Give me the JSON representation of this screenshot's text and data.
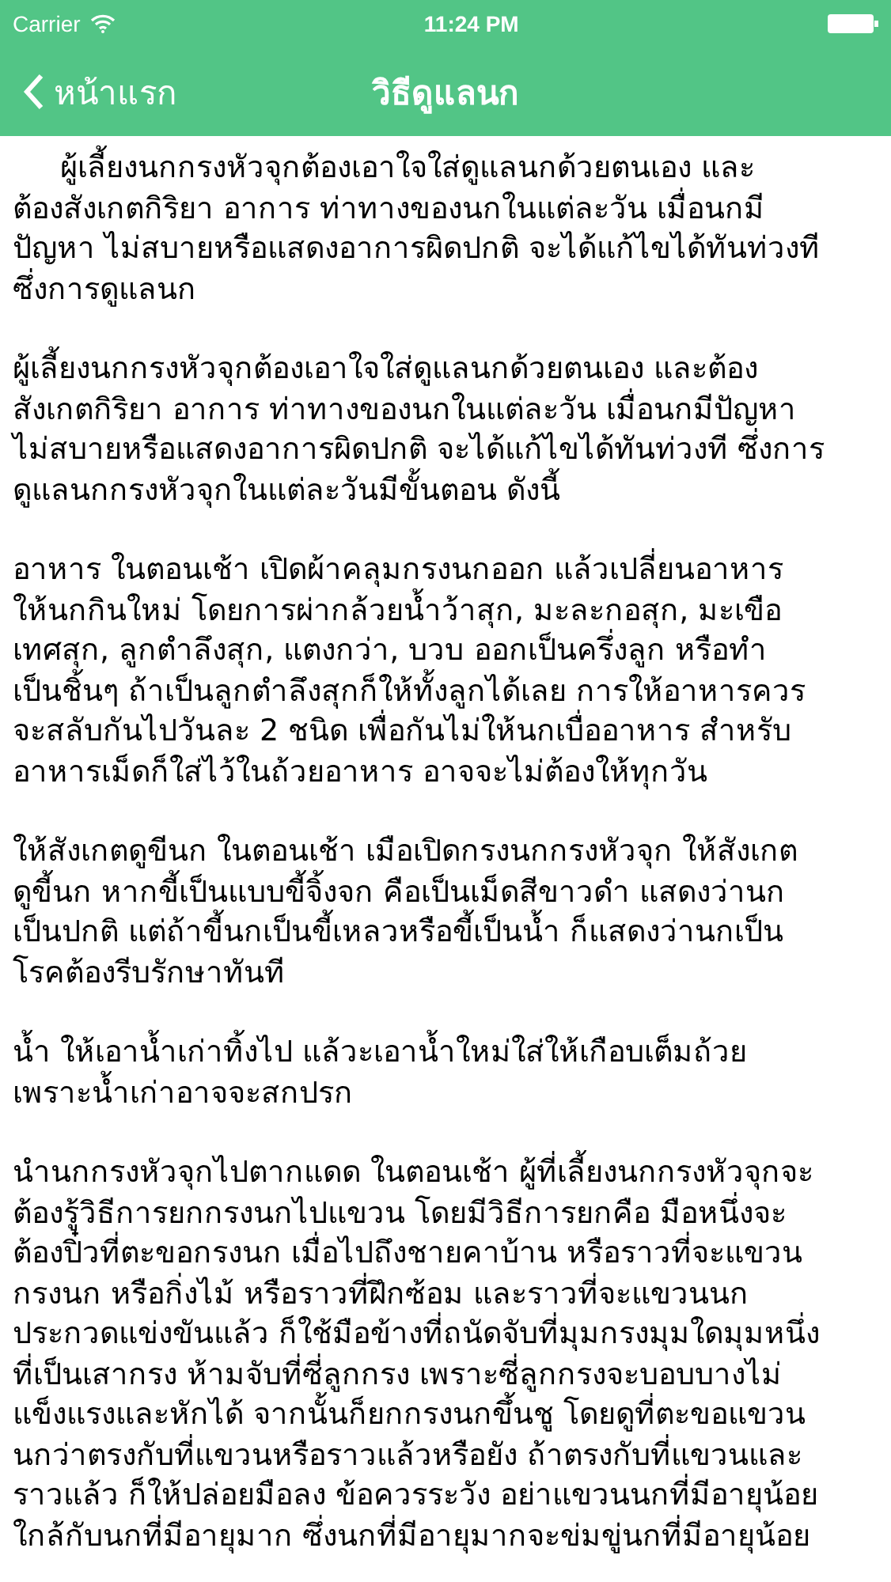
{
  "status_bar": {
    "carrier": "Carrier",
    "time": "11:24 PM"
  },
  "nav_bar": {
    "back_label": "หน้าแรก",
    "title": "วิธีดูแลนก"
  },
  "paragraphs": [
    {
      "indented": true,
      "lines": [
        "ผู้เลี้ยงนกกรงหัวจุกต้องเอาใจใส่ดูแลนกด้วยตนเอง และ",
        "ต้องสังเกตกิริยา อาการ ท่าทางของนกในแต่ละวัน เมื่อนกมี",
        "ปัญหา ไม่สบายหรือแสดงอาการผิดปกติ จะได้แก้ไขได้ทันท่วงที",
        "ซึ่งการดูแลนก"
      ]
    },
    {
      "indented": false,
      "lines": [
        "ผู้เลี้ยงนกกรงหัวจุกต้องเอาใจใส่ดูแลนกด้วยตนเอง และต้อง",
        "สังเกตกิริยา อาการ ท่าทางของนกในแต่ละวัน เมื่อนกมีปัญหา",
        "ไม่สบายหรือแสดงอาการผิดปกติ จะได้แก้ไขได้ทันท่วงที ซึ่งการ",
        "ดูแลนกกรงหัวจุกในแต่ละวันมีขั้นตอน ดังนี้"
      ]
    },
    {
      "indented": false,
      "lines": [
        "อาหาร ในตอนเช้า เปิดผ้าคลุมกรงนกออก แล้วเปลี่ยนอาหาร",
        "ให้นกกินใหม่ โดยการผ่ากล้วยน้ำว้าสุก, มะละกอสุก, มะเขือ",
        "เทศสุก, ลูกตำลึงสุก, แตงกว่า, บวบ ออกเป็นครึ่งลูก หรือทำ",
        "เป็นชิ้นๆ ถ้าเป็นลูกตำลึงสุกก็ให้ทั้งลูกได้เลย การให้อาหารควร",
        "จะสลับกันไปวันละ 2 ชนิด เพื่อกันไม่ให้นกเบื่ออาหาร สำหรับ",
        "อาหารเม็ดก็ใส่ไว้ในถ้วยอาหาร อาจจะไม่ต้องให้ทุกวัน"
      ]
    },
    {
      "indented": false,
      "lines": [
        "ให้สังเกตดูขีนก ในตอนเช้า เมือเปิดกรงนกกรงหัวจุก ให้สังเกต",
        "ดูขี้นก หากขี้เป็นแบบขี้จิ้งจก คือเป็นเม็ดสีขาวดำ แสดงว่านก",
        "เป็นปกติ แต่ถ้าขี้นกเป็นขี้เหลวหรือขี้เป็นน้ำ ก็แสดงว่านกเป็น",
        "โรคต้องรีบรักษาทันที"
      ]
    },
    {
      "indented": false,
      "lines": [
        "น้ำ ให้เอาน้ำเก่าทิ้งไป แล้วะเอาน้ำใหม่ใส่ให้เกือบเต็มถ้วย",
        "เพราะน้ำเก่าอาจจะสกปรก"
      ]
    },
    {
      "indented": false,
      "lines": [
        "นำนกกรงหัวจุกไปตากแดด ในตอนเช้า ผู้ที่เลี้ยงนกกรงหัวจุกจะ",
        "ต้องรู้วิธีการยกกรงนกไปแขวน โดยมีวิธีการยกคือ มือหนึ่งจะ",
        "ต้องปิ๋วที่ตะขอกรงนก เมื่อไปถึงชายคาบ้าน หรือราวที่จะแขวน",
        "กรงนก หรือกิ่งไม้ หรือราวที่ฝึกซ้อม และราวที่จะแขวนนก",
        "ประกวดแข่งขันแล้ว ก็ใช้มือข้างที่ถนัดจับที่มุมกรงมุมใดมุมหนึ่ง",
        "ที่เป็นเสากรง ห้ามจับที่ซี่ลูกกรง เพราะซี่ลูกกรงจะบอบบางไม่",
        "แข็งแรงและหักได้ จากนั้นก็ยกกรงนกขึ้นชู โดยดูที่ตะขอแขวน",
        "นกว่าตรงกับที่แขวนหรือราวแล้วหรือยัง ถ้าตรงกับที่แขวนและ",
        "ราวแล้ว ก็ให้ปล่อยมือลง ข้อควรระวัง อย่าแขวนนกที่มีอายุน้อย",
        "ใกล้กับนกที่มีอายุมาก ซึ่งนกที่มีอายุมากจะข่มขู่นกที่มีอายุน้อย"
      ]
    }
  ]
}
